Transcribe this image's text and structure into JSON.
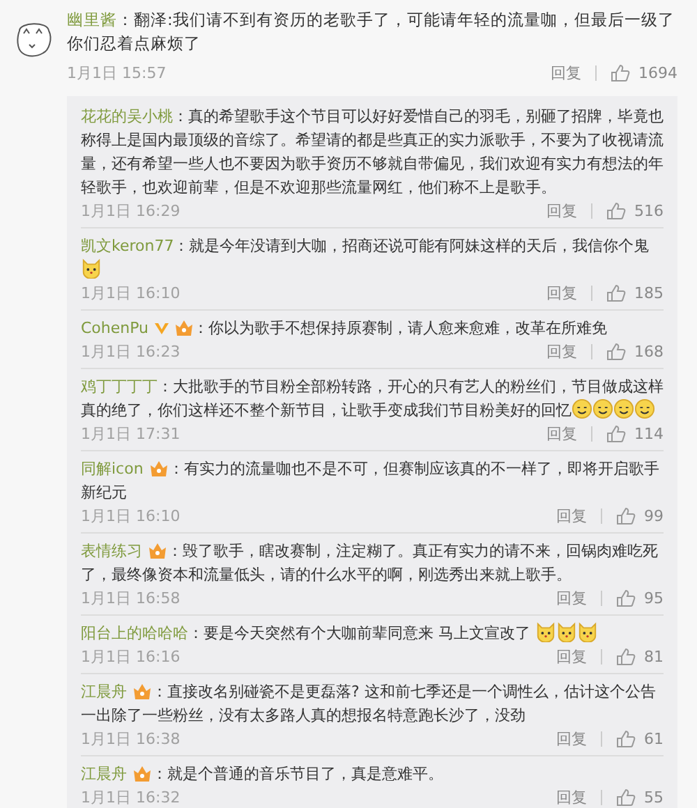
{
  "top_comment": {
    "user": "幽里酱",
    "text": "：翻泽:我们请不到有资历的老歌手了，可能请年轻的流量咖，但最后一级了你们忍着点麻烦了",
    "time": "1月1日 15:57",
    "reply_label": "回复",
    "likes": "1694"
  },
  "replies": [
    {
      "user": "花花的吴小桃",
      "verified": false,
      "vip": false,
      "text": "：真的希望歌手这个节目可以好好爱惜自己的羽毛，别砸了招牌，毕竟也称得上是国内最顶级的音综了。希望请的都是些真正的实力派歌手，不要为了收视请流量，还有希望一些人也不要因为歌手资历不够就自带偏见，我们欢迎有实力有想法的年轻歌手，也欢迎前辈，但是不欢迎那些流量网红，他们称不上是歌手。",
      "time": "1月1日 16:29",
      "reply_label": "回复",
      "likes": "516"
    },
    {
      "user": "凯文keron77",
      "verified": false,
      "vip": false,
      "text": "：就是今年没请到大咖，招商还说可能有阿妹这样的天后，我信你个鬼",
      "emojis": [
        {
          "kind": "cat"
        }
      ],
      "time": "1月1日 16:10",
      "reply_label": "回复",
      "likes": "185"
    },
    {
      "user": "CohenPu",
      "verified": true,
      "vip": true,
      "text": "：你以为歌手不想保持原赛制，请人愈来愈难，改革在所难免",
      "time": "1月1日 16:23",
      "reply_label": "回复",
      "likes": "168"
    },
    {
      "user": "鸡丁丁丁丁",
      "verified": false,
      "vip": false,
      "text": "：大批歌手的节目粉全部粉转路，开心的只有艺人的粉丝们，节目做成这样真的绝了，你们这样还不整个新节目，让歌手变成我们节目粉美好的回忆",
      "emojis": [
        {
          "kind": "smile"
        },
        {
          "kind": "smile"
        },
        {
          "kind": "smile"
        },
        {
          "kind": "smile"
        }
      ],
      "time": "1月1日 17:31",
      "reply_label": "回复",
      "likes": "114"
    },
    {
      "user": "同解icon",
      "verified": false,
      "vip": true,
      "text": "：有实力的流量咖也不是不可，但赛制应该真的不一样了，即将开启歌手新纪元",
      "time": "1月1日 16:10",
      "reply_label": "回复",
      "likes": "99"
    },
    {
      "user": "表情练习",
      "verified": false,
      "vip": true,
      "text": "：毁了歌手，瞎改赛制，注定糊了。真正有实力的请不来，回锅肉难吃死了，最终像资本和流量低头，请的什么水平的啊，刚选秀出来就上歌手。",
      "time": "1月1日 16:58",
      "reply_label": "回复",
      "likes": "95"
    },
    {
      "user": "阳台上的哈哈哈",
      "verified": false,
      "vip": false,
      "text": "：要是今天突然有个大咖前辈同意来 马上文宣改了 ",
      "emojis": [
        {
          "kind": "cat"
        },
        {
          "kind": "cat"
        },
        {
          "kind": "cat"
        }
      ],
      "time": "1月1日 16:16",
      "reply_label": "回复",
      "likes": "81"
    },
    {
      "user": "江晨舟",
      "verified": false,
      "vip": true,
      "text": "：直接改名别碰瓷不是更磊落? 这和前七季还是一个调性么，估计这个公告一出除了一些粉丝，没有太多路人真的想报名特意跑长沙了，没劲",
      "time": "1月1日 16:38",
      "reply_label": "回复",
      "likes": "61"
    },
    {
      "user": "江晨舟",
      "verified": false,
      "vip": true,
      "text": "：就是个普通的音乐节目了，真是意难平。",
      "time": "1月1日 16:32",
      "reply_label": "回复",
      "likes": "55"
    }
  ]
}
